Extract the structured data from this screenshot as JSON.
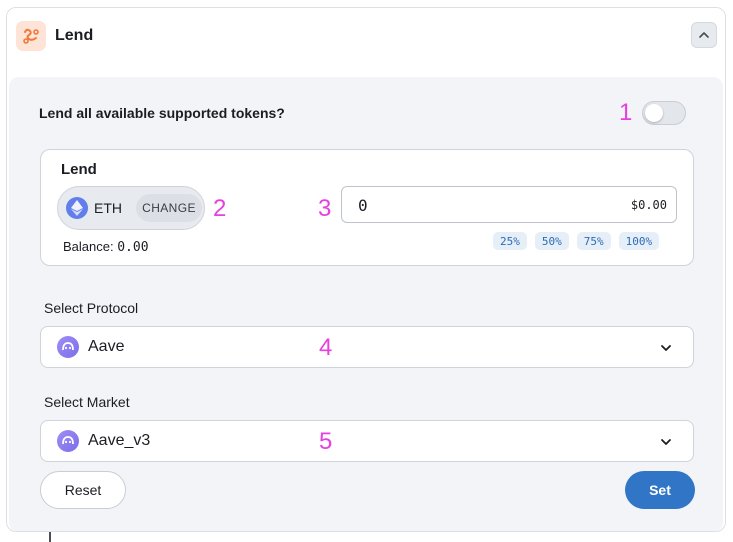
{
  "header": {
    "title": "Lend",
    "icon": "lend-action-icon",
    "collapse_icon": "chevron-up-icon"
  },
  "lend_all": {
    "question": "Lend all available supported tokens?",
    "enabled": false
  },
  "lend_panel": {
    "title": "Lend",
    "token": {
      "symbol": "ETH",
      "icon": "eth-icon"
    },
    "change_label": "CHANGE",
    "balance_label": "Balance:",
    "balance_value": "0.00",
    "amount_value": "0",
    "amount_usd": "$0.00",
    "percent_options": [
      "25%",
      "50%",
      "75%",
      "100%"
    ]
  },
  "protocol": {
    "label": "Select Protocol",
    "value": "Aave",
    "icon": "aave-icon"
  },
  "market": {
    "label": "Select Market",
    "value": "Aave_v3",
    "icon": "aave-icon"
  },
  "footer": {
    "reset_label": "Reset",
    "set_label": "Set"
  },
  "annotations": [
    "1",
    "2",
    "3",
    "4",
    "5"
  ],
  "colors": {
    "accent": "#3176c6",
    "annotation": "#e83fe0",
    "panel_bg": "#f2f4f7",
    "eth": "#627eea",
    "aave": "#9f8ef7"
  }
}
